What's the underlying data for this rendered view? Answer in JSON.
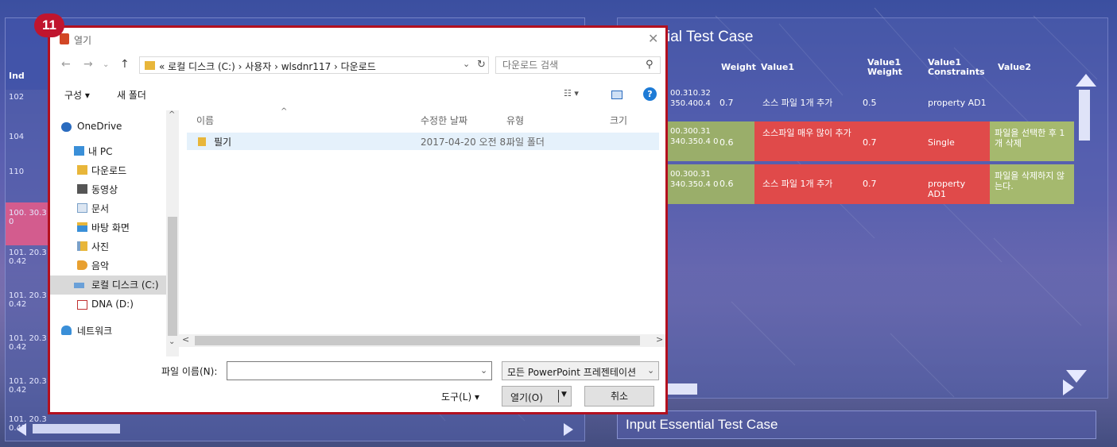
{
  "badge": "11",
  "left_panel": {
    "header": "Ind",
    "rows": [
      {
        "text": "102",
        "highlight": false
      },
      {
        "text": "104",
        "highlight": false
      },
      {
        "text": "110",
        "highlight": false
      },
      {
        "text": "100. 30.3 0",
        "highlight": true
      },
      {
        "text": "101. 20.3 0.42",
        "highlight": false
      },
      {
        "text": "101. 20.3 0.42",
        "highlight": false
      },
      {
        "text": "101. 20.3 0.42",
        "highlight": false
      },
      {
        "text": "101. 20.3 0.42",
        "highlight": false
      },
      {
        "text": "101. 20.3 0.42",
        "highlight": false
      }
    ]
  },
  "right_panel": {
    "title": "ial Test Case",
    "headers": {
      "weight": "Weight",
      "value1": "Value1",
      "value1_weight": "Value1 Weight",
      "value1_constraints": "Value1 Constraints",
      "value2": "Value2"
    },
    "rows": [
      {
        "id": "00.310.32 350.400.4",
        "weight": "0.7",
        "value1": "소스 파일 1개 추가",
        "v1weight": "0.5",
        "v1constraints": "property AD1",
        "value2": "",
        "bg": "none",
        "v1bg": "none",
        "v2bg": "none"
      },
      {
        "id": "00.300.31 340.350.4 0",
        "weight": "0.6",
        "value1": "소스파일 매우 많이 추가",
        "v1weight": "0.7",
        "v1constraints": "Single",
        "value2": "파일을 선택한 후 1개 삭제",
        "bg": "#9aae6a",
        "v1bg": "#e04a4a",
        "v2bg": "#a5b96e"
      },
      {
        "id": "00.300.31 340.350.4 0",
        "weight": "0.6",
        "value1": "소스 파일 1개 추가",
        "v1weight": "0.7",
        "v1constraints": "property AD1",
        "value2": "파일을 삭제하지 않는다.",
        "bg": "#9aae6a",
        "v1bg": "#e04a4a",
        "v2bg": "#a5b96e"
      }
    ]
  },
  "bottom_bar": "Input Essential Test Case",
  "dialog": {
    "title": "열기",
    "path": "« 로컬 디스크 (C:) › 사용자 › wlsdnr117 › 다운로드",
    "search_placeholder": "다운로드 검색",
    "toolbar": {
      "organize": "구성 ▾",
      "new_folder": "새 폴더"
    },
    "nav_items": [
      {
        "label": "OneDrive",
        "icon": "cloud-icon",
        "color": "#2a6bbf"
      },
      {
        "label": "내 PC",
        "icon": "pc-icon",
        "color": "#3a8fd8"
      },
      {
        "label": "다운로드",
        "icon": "download-folder-icon",
        "color": "#3a8fd8"
      },
      {
        "label": "동영상",
        "icon": "video-folder-icon",
        "color": "#555"
      },
      {
        "label": "문서",
        "icon": "document-folder-icon",
        "color": "#7aa0c8"
      },
      {
        "label": "바탕 화면",
        "icon": "desktop-folder-icon",
        "color": "#3a8fd8"
      },
      {
        "label": "사진",
        "icon": "picture-folder-icon",
        "color": "#7aa0c8"
      },
      {
        "label": "음악",
        "icon": "music-folder-icon",
        "color": "#e8a030"
      },
      {
        "label": "로컬 디스크 (C:)",
        "icon": "drive-icon",
        "color": "#6aa0d8"
      },
      {
        "label": "DNA (D:)",
        "icon": "usb-drive-icon",
        "color": "#c03030"
      },
      {
        "label": "네트워크",
        "icon": "network-icon",
        "color": "#3a8fd8"
      }
    ],
    "columns": {
      "name": "이름",
      "modified": "수정한 날짜",
      "type": "유형",
      "size": "크기"
    },
    "files": [
      {
        "name": "필기",
        "modified": "2017-04-20 오전 8...",
        "type": "파일 폴더",
        "size": ""
      }
    ],
    "filename_label": "파일 이름(N):",
    "filename_value": "",
    "filetype": "모든 PowerPoint 프레젠테이션",
    "tools_label": "도구(L)  ▾",
    "open_label": "열기(O)",
    "cancel_label": "취소"
  }
}
